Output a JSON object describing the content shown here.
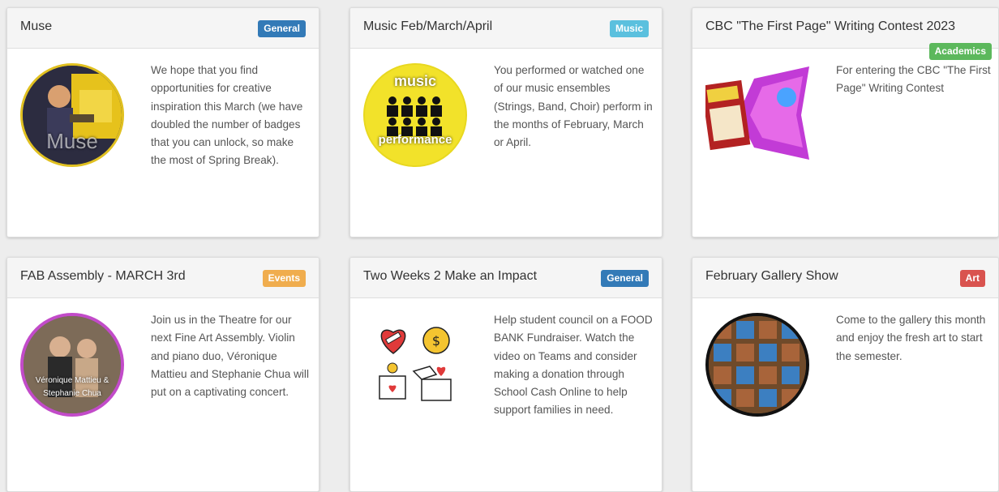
{
  "cards": [
    {
      "title": "Muse",
      "badge": "General",
      "badge_color": "#337ab7",
      "description": "We hope that you find opportunities for creative inspiration this March (we have doubled the number of badges that you can unlock, so make the most of Spring Break).",
      "image_icon": "muse-badge-image",
      "image_text": "Muse"
    },
    {
      "title": "Music Feb/March/April",
      "badge": "Music",
      "badge_color": "#5bc0de",
      "description": "You performed or watched one of our music ensembles (Strings, Band, Choir) perform in the months of February, March or April.",
      "image_icon": "music-performance-badge-image",
      "image_text_top": "music",
      "image_text_bottom": "performance"
    },
    {
      "title": "CBC \"The First Page\" Writing Contest 2023",
      "badge": "Academics",
      "badge_color": "#5cb85c",
      "description": "For entering the CBC \"The First Page\" Writing Contest",
      "image_icon": "cbc-first-page-contest-image"
    },
    {
      "title": "FAB Assembly - MARCH 3rd",
      "badge": "Events",
      "badge_color": "#f0ad4e",
      "description": "Join us in the Theatre for our next Fine Art Assembly. Violin and piano duo, Véronique Mattieu and Stephanie Chua will put on a captivating concert.",
      "image_icon": "fab-assembly-duo-image",
      "image_text": "Véronique Mattieu & Stephanie Chua"
    },
    {
      "title": "Two Weeks 2 Make an Impact",
      "badge": "General",
      "badge_color": "#337ab7",
      "description": "Help student council on a FOOD BANK Fundraiser. Watch the video on Teams and consider making a donation through School Cash Online to help support families in need.",
      "image_icon": "donation-icons-image"
    },
    {
      "title": "February Gallery Show",
      "badge": "Art",
      "badge_color": "#d9534f",
      "description": "Come to the gallery this month and enjoy the fresh art to start the semester.",
      "image_icon": "gallery-show-badge-image"
    }
  ]
}
